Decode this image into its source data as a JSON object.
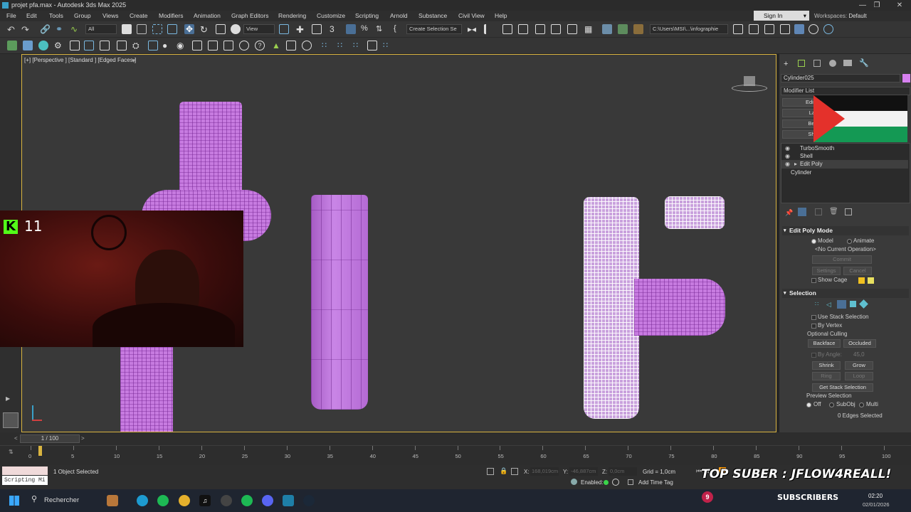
{
  "window": {
    "title": "projet pfa.max - Autodesk 3ds Max 2025"
  },
  "menu": [
    "File",
    "Edit",
    "Tools",
    "Group",
    "Views",
    "Create",
    "Modifiers",
    "Animation",
    "Graph Editors",
    "Rendering",
    "Customize",
    "Scripting",
    "Arnold",
    "Substance",
    "Civil View",
    "Help"
  ],
  "account": {
    "signin": "Sign In",
    "workspaces_label": "Workspaces:",
    "workspace": "Default"
  },
  "toolbar": {
    "filter": "All",
    "coord": "View",
    "selection_set": "Create Selection Se",
    "path": "C:\\Users\\MSI\\...\\infographie"
  },
  "viewport": {
    "label": "[+] [Perspective ] [Standard ] [Edged Faces ]"
  },
  "overlay": {
    "follower_count": "11",
    "banner": "TOP SUBER : JFLOW4REALL!",
    "subs_count": "9",
    "subs_label": "SUBSCRIBERS"
  },
  "panel": {
    "object_name": "Cylinder025",
    "object_color": "#d781f0",
    "modifier_list": "Modifier List",
    "quick_buttons": [
      "Edit P",
      "Lat",
      "Ben",
      "She"
    ],
    "stack": [
      "TurboSmooth",
      "Shell",
      "Edit Poly",
      "Cylinder"
    ],
    "edit_poly_mode": {
      "header": "Edit Poly Mode",
      "model": "Model",
      "animate": "Animate",
      "operation": "<No Current Operation>",
      "commit": "Commit",
      "settings": "Settings",
      "cancel": "Cancel",
      "show_cage": "Show Cage"
    },
    "selection": {
      "header": "Selection",
      "use_stack": "Use Stack Selection",
      "by_vertex": "By Vertex",
      "optional_culling": "Optional Culling",
      "backface": "Backface",
      "occluded": "Occluded",
      "by_angle": "By Angle:",
      "angle_value": "45,0",
      "shrink": "Shrink",
      "grow": "Grow",
      "ring": "Ring",
      "loop": "Loop",
      "get_stack": "Get Stack Selection",
      "preview": "Preview Selection",
      "off": "Off",
      "subobj": "SubObj",
      "multi": "Multi",
      "edges_selected": "0 Edges Selected"
    }
  },
  "timeline": {
    "frame": "1 / 100",
    "ticks": [
      "0",
      "5",
      "10",
      "15",
      "20",
      "25",
      "30",
      "35",
      "40",
      "45",
      "50",
      "55",
      "60",
      "65",
      "70",
      "75",
      "80",
      "85",
      "90",
      "95",
      "100"
    ]
  },
  "status": {
    "objects_selected": "1 Object Selected",
    "script_label": "Scripting Mi",
    "x_label": "X:",
    "x_value": "168,019cm",
    "y_label": "Y:",
    "y_value": "-46,887cm",
    "z_label": "Z:",
    "z_value": "0,0cm",
    "grid": "Grid = 1,0cm",
    "enabled": "Enabled:",
    "add_time_tag": "Add Time Tag"
  },
  "taskbar": {
    "search": "Rechercher",
    "time": "02:20",
    "date": "02/01/2026"
  },
  "colors": {
    "accent": "#d9b440",
    "pipe": "#c77be0",
    "flag_red": "#e4312b",
    "flag_green": "#149954"
  }
}
